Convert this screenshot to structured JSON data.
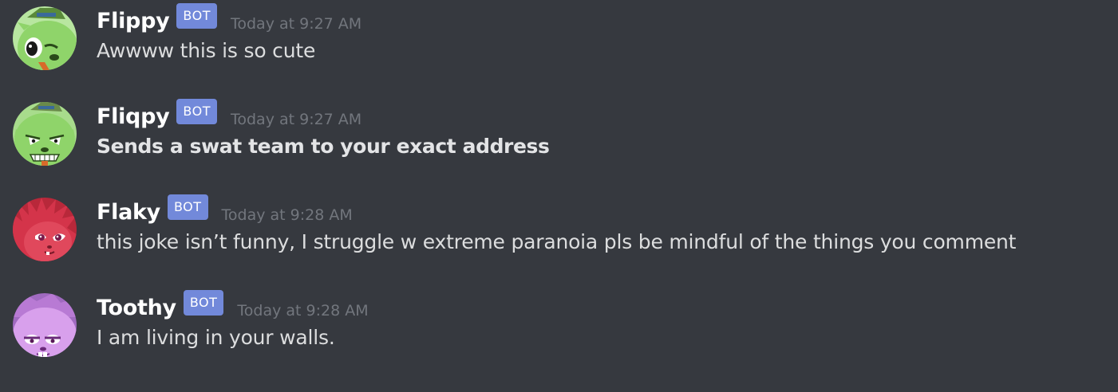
{
  "messages": [
    {
      "username": "Flippy",
      "tag": "BOT",
      "timestamp": "Today at 9:27 AM",
      "content": "Awwww this is so cute",
      "bold": false,
      "avatar_icon": "green-bear-avatar-icon"
    },
    {
      "username": "Fliqpy",
      "tag": "BOT",
      "timestamp": "Today at 9:27 AM",
      "content": "Sends a swat team to your exact address",
      "bold": true,
      "avatar_icon": "green-bear-evil-avatar-icon"
    },
    {
      "username": "Flaky",
      "tag": "BOT",
      "timestamp": "Today at 9:28 AM",
      "content": "this joke isn’t funny, I struggle w extreme paranoia pls be mindful of the things you comment",
      "bold": false,
      "avatar_icon": "red-porcupine-avatar-icon"
    },
    {
      "username": "Toothy",
      "tag": "BOT",
      "timestamp": "Today at 9:28 AM",
      "content": "I am living in your walls.",
      "bold": false,
      "avatar_icon": "purple-beaver-avatar-icon"
    }
  ],
  "colors": {
    "background": "#36393f",
    "username": "#ffffff",
    "bot_tag": "#7289da",
    "timestamp": "#72767d",
    "message_text": "#dcddde"
  }
}
